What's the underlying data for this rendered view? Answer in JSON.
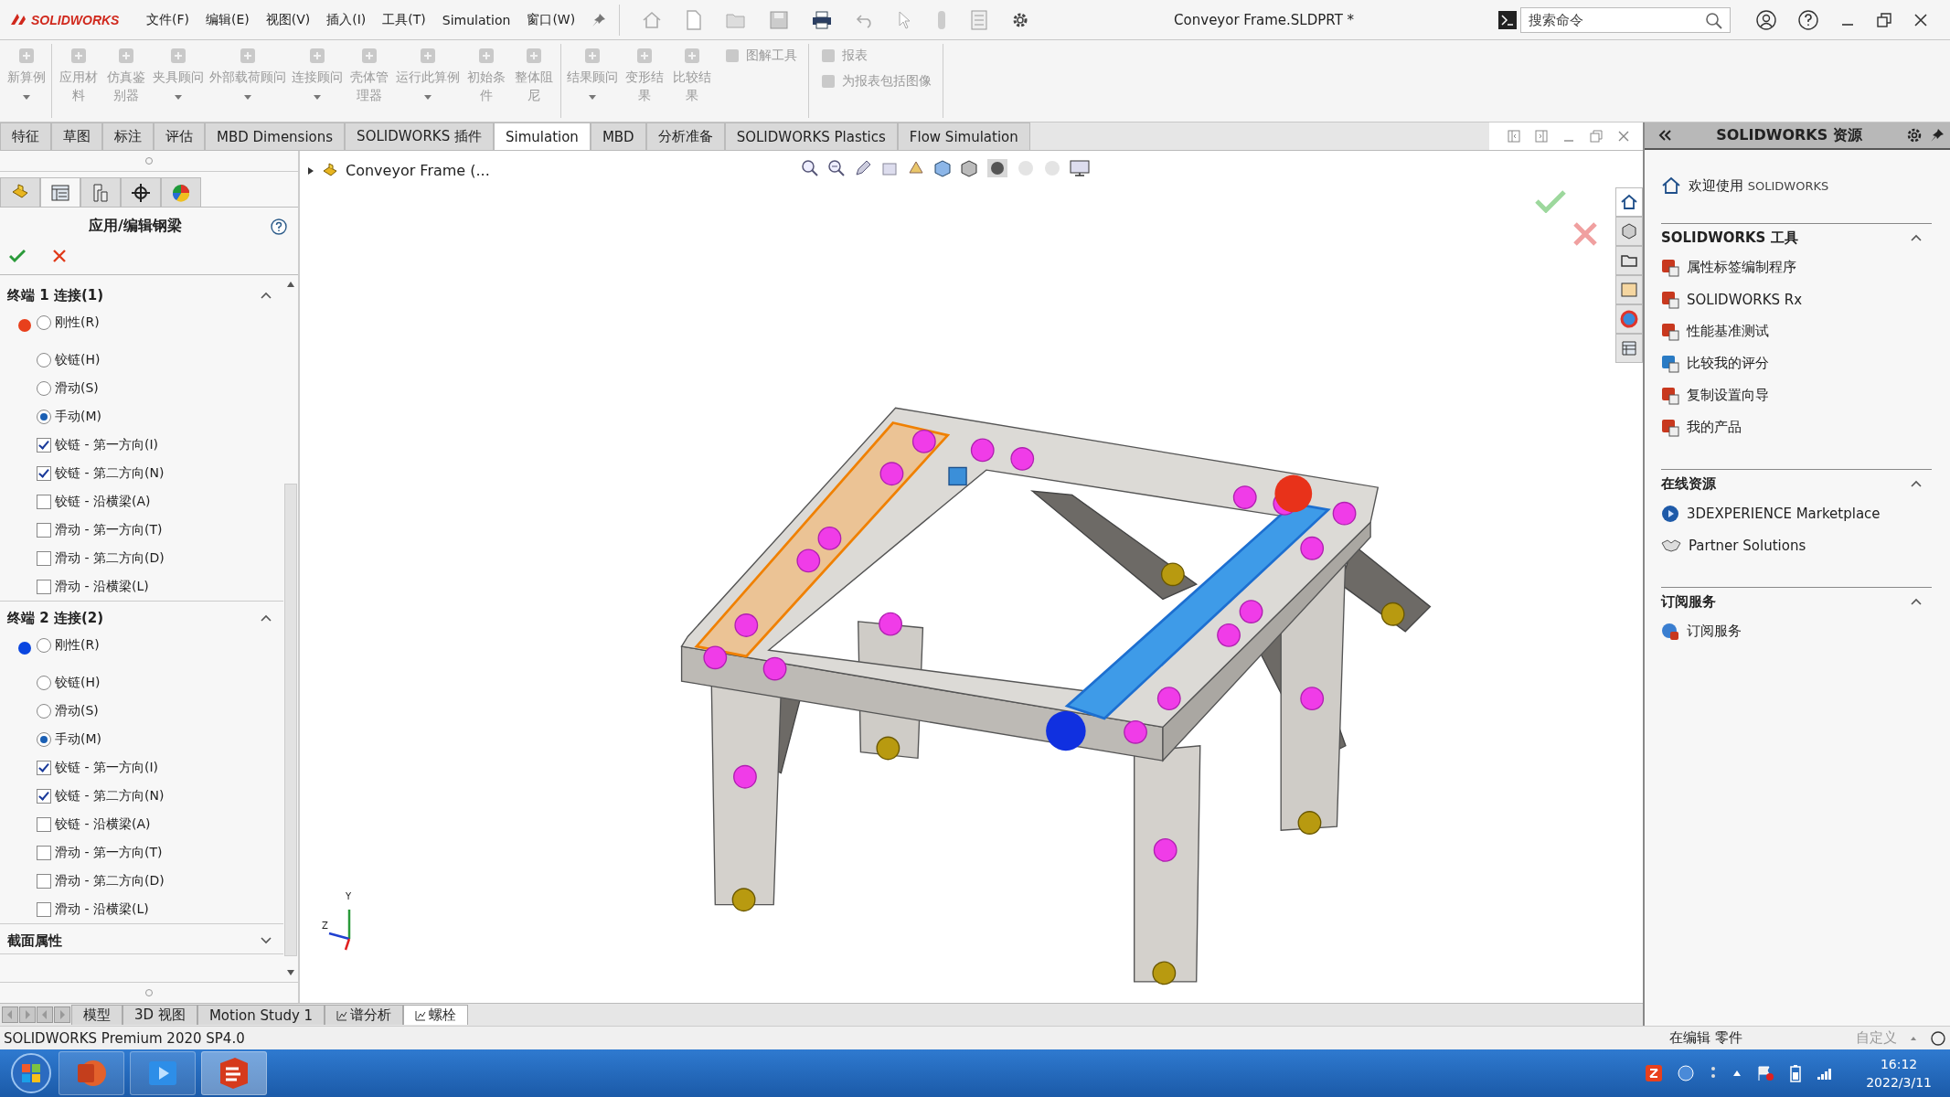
{
  "app": {
    "logo": "SOLIDWORKS",
    "menus": [
      "文件(F)",
      "编辑(E)",
      "视图(V)",
      "插入(I)",
      "工具(T)",
      "Simulation",
      "窗口(W)"
    ],
    "document_title": "Conveyor Frame.SLDPRT *",
    "search": {
      "placeholder": "搜索命令"
    }
  },
  "ribbon": {
    "groups": [
      {
        "buttons": [
          {
            "label": "新算例",
            "dropdown": true,
            "disabled": true
          }
        ]
      },
      {
        "buttons": [
          {
            "label": "应用材料",
            "dropdown": false,
            "disabled": true
          },
          {
            "label": "仿真鉴别器",
            "dropdown": false,
            "disabled": true
          },
          {
            "label": "夹具顾问",
            "dropdown": true,
            "disabled": true
          },
          {
            "label": "外部载荷顾问",
            "dropdown": true,
            "disabled": true
          },
          {
            "label": "连接顾问",
            "dropdown": true,
            "disabled": true
          },
          {
            "label": "壳体管理器",
            "dropdown": false,
            "disabled": true
          },
          {
            "label": "运行此算例",
            "dropdown": true,
            "disabled": true
          },
          {
            "label": "初始条件",
            "dropdown": false,
            "disabled": true
          },
          {
            "label": "整体阻尼",
            "dropdown": false,
            "disabled": true
          }
        ]
      },
      {
        "buttons": [
          {
            "label": "结果顾问",
            "dropdown": true,
            "disabled": true
          },
          {
            "label": "变形结果",
            "dropdown": false,
            "disabled": true
          },
          {
            "label": "比较结果",
            "dropdown": false,
            "disabled": true
          }
        ],
        "small_items": [
          {
            "label": "图解工具",
            "disabled": true
          }
        ]
      },
      {
        "small_items": [
          {
            "label": "报表",
            "disabled": true
          },
          {
            "label": "为报表包括图像",
            "disabled": true
          }
        ]
      }
    ]
  },
  "tabs": [
    {
      "label": "特征",
      "selected": false
    },
    {
      "label": "草图",
      "selected": false
    },
    {
      "label": "标注",
      "selected": false
    },
    {
      "label": "评估",
      "selected": false
    },
    {
      "label": "MBD Dimensions",
      "selected": false
    },
    {
      "label": "SOLIDWORKS 插件",
      "selected": false
    },
    {
      "label": "Simulation",
      "selected": true
    },
    {
      "label": "MBD",
      "selected": false
    },
    {
      "label": "分析准备",
      "selected": false
    },
    {
      "label": "SOLIDWORKS Plastics",
      "selected": false
    },
    {
      "label": "Flow Simulation",
      "selected": false
    }
  ],
  "property_manager": {
    "icon_tabs": [
      {
        "selected": false
      },
      {
        "selected": true
      },
      {
        "selected": false
      },
      {
        "selected": false
      },
      {
        "selected": false
      }
    ],
    "title": "应用/编辑钢梁",
    "sections": [
      {
        "title": "终端 1 连接(1)",
        "expanded": true,
        "color": "#e8401c",
        "options": [
          {
            "kind": "radio",
            "label": "刚性(R)",
            "selected": false
          },
          {
            "kind": "radio",
            "label": "铰链(H)",
            "selected": false
          },
          {
            "kind": "radio",
            "label": "滑动(S)",
            "selected": false
          },
          {
            "kind": "radio",
            "label": "手动(M)",
            "selected": true
          },
          {
            "kind": "checkbox",
            "label": "铰链 - 第一方向(I)",
            "checked": true
          },
          {
            "kind": "checkbox",
            "label": "铰链 - 第二方向(N)",
            "checked": true
          },
          {
            "kind": "checkbox",
            "label": "铰链 - 沿横梁(A)",
            "checked": false
          },
          {
            "kind": "checkbox",
            "label": "滑动 - 第一方向(T)",
            "checked": false
          },
          {
            "kind": "checkbox",
            "label": "滑动 - 第二方向(D)",
            "checked": false
          },
          {
            "kind": "checkbox",
            "label": "滑动 - 沿横梁(L)",
            "checked": false
          }
        ]
      },
      {
        "title": "终端 2 连接(2)",
        "expanded": true,
        "color": "#0a46e0",
        "options": [
          {
            "kind": "radio",
            "label": "刚性(R)",
            "selected": false
          },
          {
            "kind": "radio",
            "label": "铰链(H)",
            "selected": false
          },
          {
            "kind": "radio",
            "label": "滑动(S)",
            "selected": false
          },
          {
            "kind": "radio",
            "label": "手动(M)",
            "selected": true
          },
          {
            "kind": "checkbox",
            "label": "铰链 - 第一方向(I)",
            "checked": true
          },
          {
            "kind": "checkbox",
            "label": "铰链 - 第二方向(N)",
            "checked": true
          },
          {
            "kind": "checkbox",
            "label": "铰链 - 沿横梁(A)",
            "checked": false
          },
          {
            "kind": "checkbox",
            "label": "滑动 - 第一方向(T)",
            "checked": false
          },
          {
            "kind": "checkbox",
            "label": "滑动 - 第二方向(D)",
            "checked": false
          },
          {
            "kind": "checkbox",
            "label": "滑动 - 沿横梁(L)",
            "checked": false
          }
        ]
      },
      {
        "title": "截面属性",
        "expanded": false
      }
    ]
  },
  "viewport": {
    "breadcrumb": "Conveyor Frame (...",
    "triad_labels": [
      "Y",
      "Z"
    ],
    "pane_tabs": [
      {
        "selected": true
      },
      {
        "selected": false
      },
      {
        "selected": false
      },
      {
        "selected": false
      },
      {
        "selected": false
      },
      {
        "selected": false
      }
    ]
  },
  "bottom_tabs": [
    {
      "label": "模型",
      "selected": false
    },
    {
      "label": "3D 视图",
      "selected": false
    },
    {
      "label": "Motion Study 1",
      "selected": false
    },
    {
      "label": "谱分析",
      "selected": false
    },
    {
      "label": "螺栓",
      "selected": true
    }
  ],
  "task_pane": {
    "title": "SOLIDWORKS 资源",
    "welcome": "欢迎使用",
    "welcome_brand": "SOLIDWORKS",
    "groups": [
      {
        "title": "SOLIDWORKS 工具",
        "expanded": true,
        "items": [
          "属性标签编制程序",
          "SOLIDWORKS Rx",
          "性能基准测试",
          "比较我的评分",
          "复制设置向导",
          "我的产品"
        ]
      },
      {
        "title": "在线资源",
        "expanded": true,
        "items": [
          "3DEXPERIENCE Marketplace",
          "Partner Solutions"
        ]
      },
      {
        "title": "订阅服务",
        "expanded": true,
        "items": [
          "订阅服务"
        ]
      }
    ]
  },
  "status_bar": {
    "version": "SOLIDWORKS Premium 2020 SP4.0",
    "mode": "在编辑 零件",
    "custom": "自定义"
  },
  "taskbar": {
    "time": "16:12",
    "date": "2022/3/11"
  }
}
